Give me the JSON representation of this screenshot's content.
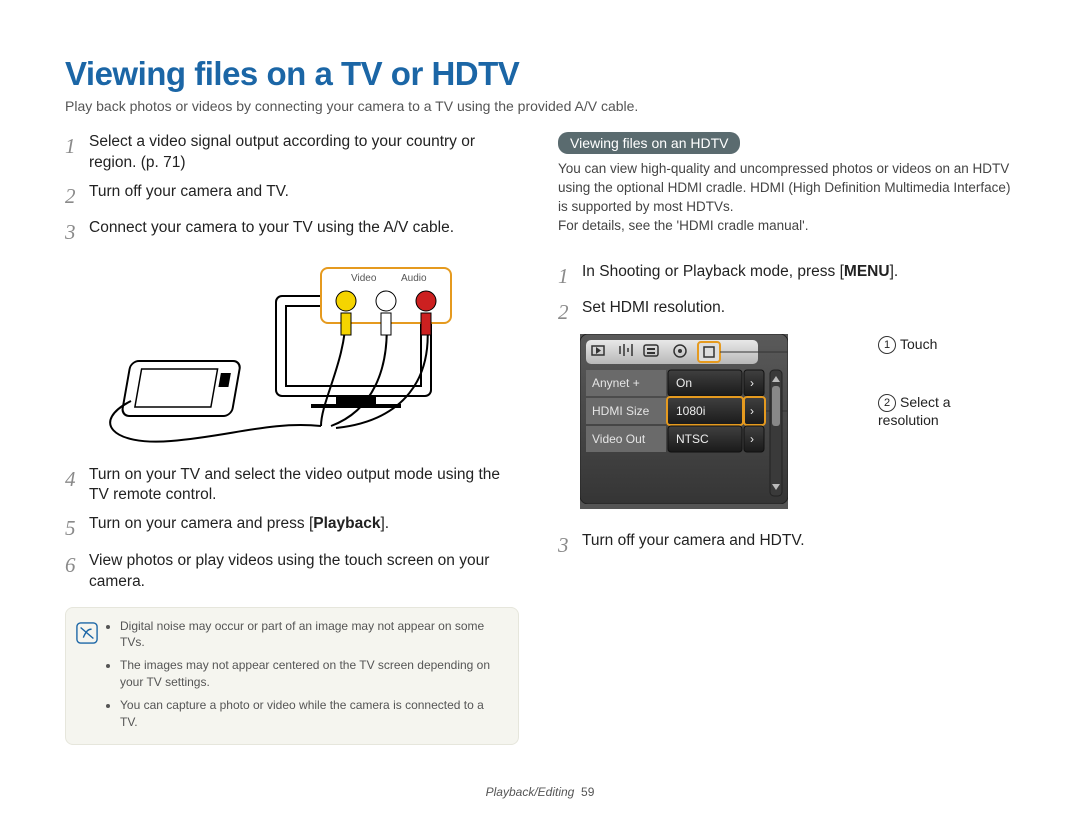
{
  "title": "Viewing files on a TV or HDTV",
  "intro": "Play back photos or videos by connecting your camera to a TV using the provided A/V cable.",
  "left_steps": [
    {
      "n": "1",
      "text": "Select a video signal output according to your country or region. (p. 71)"
    },
    {
      "n": "2",
      "text": "Turn off your camera and TV."
    },
    {
      "n": "3",
      "text": "Connect your camera to your TV using the A/V cable."
    },
    {
      "n": "4",
      "text": "Turn on your TV and select the video output mode using the TV remote control."
    },
    {
      "n": "5",
      "text": "Turn on your camera and press [Playback]."
    },
    {
      "n": "6",
      "text": "View photos or play videos using the touch screen on your camera."
    }
  ],
  "left_fig_labels": {
    "video": "Video",
    "audio": "Audio"
  },
  "tips": [
    "Digital noise may occur or part of an image may not appear on some TVs.",
    "The images may not appear centered on the TV screen depending on your TV settings.",
    "You can capture a photo or video while the camera is connected to a TV."
  ],
  "hdtv_heading": "Viewing files on an HDTV",
  "hdtv_para": "You can view high-quality and uncompressed photos or videos on an HDTV using the optional HDMI cradle. HDMI (High Definition Multimedia Interface) is supported by most HDTVs.\nFor details, see the 'HDMI cradle manual'.",
  "right_steps": [
    {
      "n": "1",
      "text": "In Shooting or Playback mode, press [MENU]."
    },
    {
      "n": "2",
      "text": "Set HDMI resolution."
    },
    {
      "n": "3",
      "text": "Turn off your camera and HDTV."
    }
  ],
  "menu_rows": [
    {
      "label": "Anynet +",
      "value": "On"
    },
    {
      "label": "HDMI Size",
      "value": "1080i"
    },
    {
      "label": "Video Out",
      "value": "NTSC"
    }
  ],
  "callouts": {
    "c1": "Touch",
    "c2": "Select a resolution"
  },
  "footer_section": "Playback/Editing",
  "footer_page": "59"
}
